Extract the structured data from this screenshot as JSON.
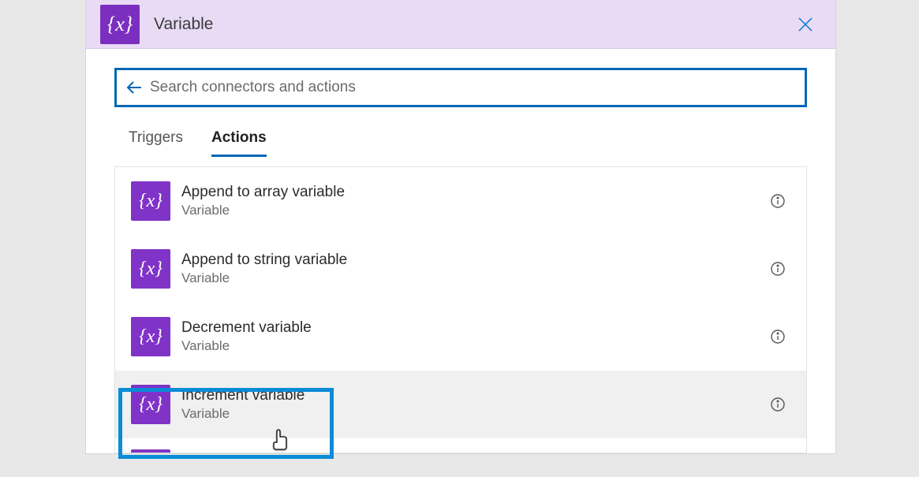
{
  "header": {
    "title": "Variable",
    "icon_glyph": "{x}"
  },
  "search": {
    "placeholder": "Search connectors and actions",
    "value": ""
  },
  "tabs": [
    {
      "label": "Triggers",
      "active": false
    },
    {
      "label": "Actions",
      "active": true
    }
  ],
  "actions": [
    {
      "title": "Append to array variable",
      "subtitle": "Variable",
      "icon_glyph": "{x}",
      "hovered": false
    },
    {
      "title": "Append to string variable",
      "subtitle": "Variable",
      "icon_glyph": "{x}",
      "hovered": false
    },
    {
      "title": "Decrement variable",
      "subtitle": "Variable",
      "icon_glyph": "{x}",
      "hovered": false
    },
    {
      "title": "Increment variable",
      "subtitle": "Variable",
      "icon_glyph": "{x}",
      "hovered": true
    }
  ],
  "colors": {
    "brand_purple": "#8033c7",
    "header_bg": "#e9dbf5",
    "accent_blue": "#0067b8",
    "highlight_blue": "#0a8cd6"
  }
}
